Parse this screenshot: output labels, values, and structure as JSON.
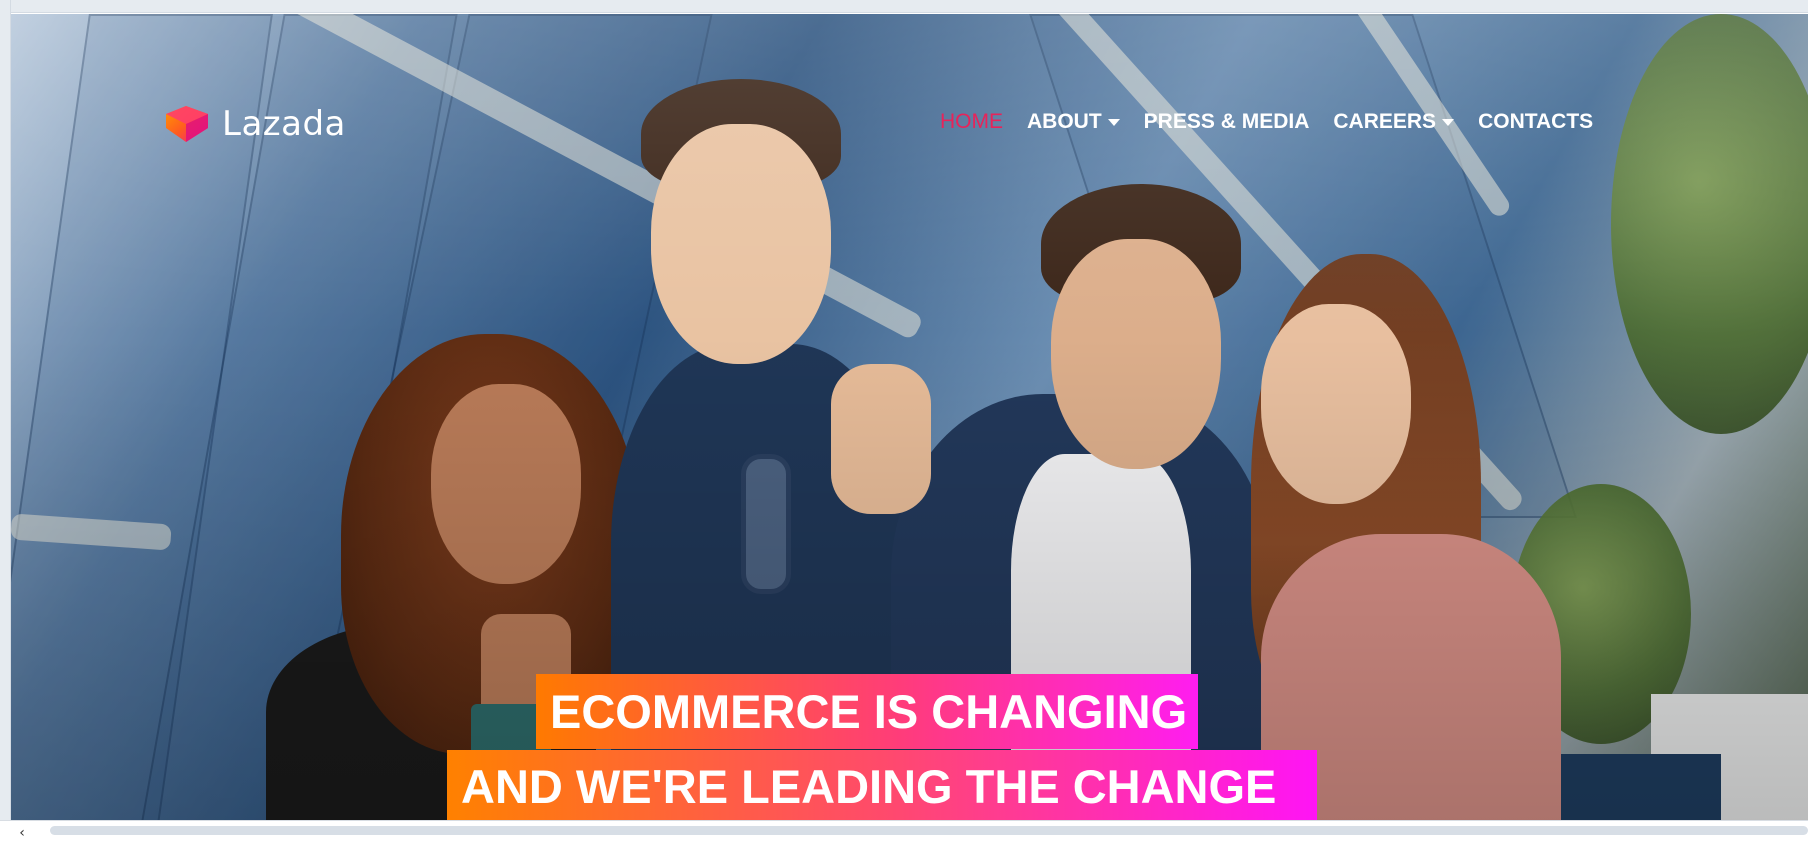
{
  "brand": {
    "name": "Lazada",
    "logo_colors": [
      "#ff5d1f",
      "#f0148c",
      "#ff9a00"
    ]
  },
  "nav": {
    "items": [
      {
        "label": "HOME",
        "active": true,
        "dropdown": false
      },
      {
        "label": "ABOUT",
        "active": false,
        "dropdown": true
      },
      {
        "label": "PRESS & MEDIA",
        "active": false,
        "dropdown": false
      },
      {
        "label": "CAREERS",
        "active": false,
        "dropdown": true
      },
      {
        "label": "CONTACTS",
        "active": false,
        "dropdown": false
      }
    ],
    "active_color": "#e8235a"
  },
  "hero": {
    "headline_line1": "ECOMMERCE IS CHANGING",
    "headline_line2": "AND WE'RE LEADING THE CHANGE",
    "gradient_start": "#ff7a00",
    "gradient_end": "#ff14f5"
  },
  "scrollbar": {
    "left_arrow": "‹"
  }
}
